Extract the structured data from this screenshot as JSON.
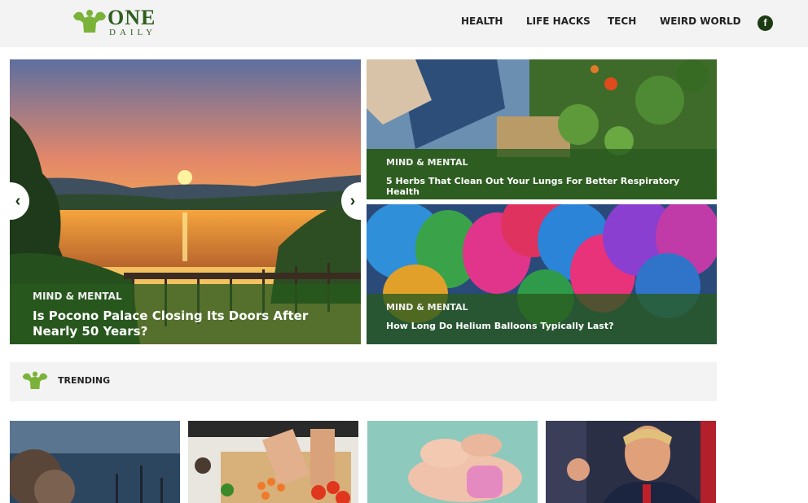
{
  "logo": {
    "name_top": "ONE",
    "name_bottom": "DAILY"
  },
  "nav": {
    "items": [
      "HEALTH",
      "LIFE HACKS",
      "TECH",
      "WEIRD WORLD"
    ]
  },
  "social": {
    "facebook_glyph": "f"
  },
  "featured": [
    {
      "category": "MIND & MENTAL",
      "title": "Is Pocono Palace Closing Its Doors After Nearly 50 Years?"
    },
    {
      "category": "MIND & MENTAL",
      "title": "5 Herbs That Clean Out Your Lungs For Better Respiratory Health"
    },
    {
      "category": "MIND & MENTAL",
      "title": "How Long Do Helium Balloons Typically Last?"
    }
  ],
  "carousel": {
    "prev_glyph": "‹",
    "next_glyph": "›"
  },
  "trending": {
    "label": "TRENDING"
  },
  "colors": {
    "brand_green": "#2f5d1f",
    "caption_bg": "#28591e",
    "header_bg": "#f3f3f3"
  }
}
